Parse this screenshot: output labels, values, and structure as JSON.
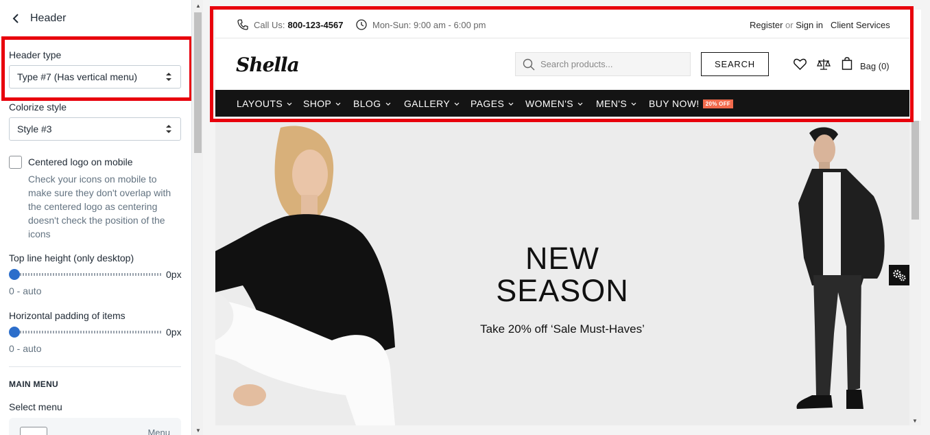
{
  "panel": {
    "title": "Header",
    "header_type": {
      "label": "Header type",
      "value": "Type #7 (Has vertical menu)"
    },
    "colorize": {
      "label": "Colorize style",
      "value": "Style #3"
    },
    "centered_logo": {
      "label": "Centered logo on mobile",
      "checked": false,
      "help": "Check your icons on mobile to make sure they don't overlap with the centered logo as centering doesn't check the position of the icons"
    },
    "top_line_height": {
      "label": "Top line height (only desktop)",
      "value": "0px",
      "note": "0 - auto",
      "level": 0
    },
    "horizontal_padding": {
      "label": "Horizontal padding of items",
      "value": "0px",
      "note": "0 - auto",
      "level": 0
    },
    "main_menu": {
      "heading": "MAIN MENU",
      "select_label": "Select menu",
      "card_text": "Menu"
    }
  },
  "store": {
    "phone_label": "Call Us:",
    "phone": "800-123-4567",
    "hours": "Mon-Sun: 9:00 am - 6:00 pm",
    "register": "Register",
    "or": "or",
    "sign_in": "Sign in",
    "client_services": "Client Services",
    "logo": "Shella",
    "search_placeholder": "Search products...",
    "search_button": "SEARCH",
    "bag": "Bag (0)",
    "nav": [
      "LAYOUTS",
      "SHOP",
      "BLOG",
      "GALLERY",
      "PAGES",
      "WOMEN'S",
      "MEN'S"
    ],
    "buy_now": "BUY NOW!",
    "badge": "20% OFF",
    "hero_title_1": "NEW",
    "hero_title_2": "SEASON",
    "hero_sub": "Take 20% off ‘Sale Must-Haves’"
  },
  "colors": {
    "highlight": "#e8000c",
    "accent": "#2c6ecb",
    "nav_bg": "#141414",
    "badge": "#f26b4d"
  }
}
